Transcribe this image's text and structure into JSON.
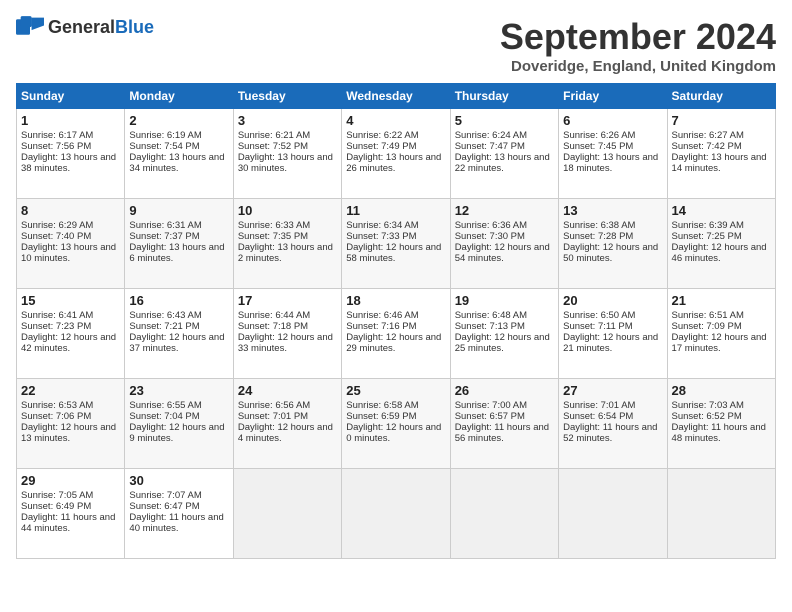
{
  "header": {
    "logo_general": "General",
    "logo_blue": "Blue",
    "month_year": "September 2024",
    "location": "Doveridge, England, United Kingdom"
  },
  "days_of_week": [
    "Sunday",
    "Monday",
    "Tuesday",
    "Wednesday",
    "Thursday",
    "Friday",
    "Saturday"
  ],
  "weeks": [
    [
      {
        "day": "1",
        "sunrise": "6:17 AM",
        "sunset": "7:56 PM",
        "daylight": "13 hours and 38 minutes."
      },
      {
        "day": "2",
        "sunrise": "6:19 AM",
        "sunset": "7:54 PM",
        "daylight": "13 hours and 34 minutes."
      },
      {
        "day": "3",
        "sunrise": "6:21 AM",
        "sunset": "7:52 PM",
        "daylight": "13 hours and 30 minutes."
      },
      {
        "day": "4",
        "sunrise": "6:22 AM",
        "sunset": "7:49 PM",
        "daylight": "13 hours and 26 minutes."
      },
      {
        "day": "5",
        "sunrise": "6:24 AM",
        "sunset": "7:47 PM",
        "daylight": "13 hours and 22 minutes."
      },
      {
        "day": "6",
        "sunrise": "6:26 AM",
        "sunset": "7:45 PM",
        "daylight": "13 hours and 18 minutes."
      },
      {
        "day": "7",
        "sunrise": "6:27 AM",
        "sunset": "7:42 PM",
        "daylight": "13 hours and 14 minutes."
      }
    ],
    [
      {
        "day": "8",
        "sunrise": "6:29 AM",
        "sunset": "7:40 PM",
        "daylight": "13 hours and 10 minutes."
      },
      {
        "day": "9",
        "sunrise": "6:31 AM",
        "sunset": "7:37 PM",
        "daylight": "13 hours and 6 minutes."
      },
      {
        "day": "10",
        "sunrise": "6:33 AM",
        "sunset": "7:35 PM",
        "daylight": "13 hours and 2 minutes."
      },
      {
        "day": "11",
        "sunrise": "6:34 AM",
        "sunset": "7:33 PM",
        "daylight": "12 hours and 58 minutes."
      },
      {
        "day": "12",
        "sunrise": "6:36 AM",
        "sunset": "7:30 PM",
        "daylight": "12 hours and 54 minutes."
      },
      {
        "day": "13",
        "sunrise": "6:38 AM",
        "sunset": "7:28 PM",
        "daylight": "12 hours and 50 minutes."
      },
      {
        "day": "14",
        "sunrise": "6:39 AM",
        "sunset": "7:25 PM",
        "daylight": "12 hours and 46 minutes."
      }
    ],
    [
      {
        "day": "15",
        "sunrise": "6:41 AM",
        "sunset": "7:23 PM",
        "daylight": "12 hours and 42 minutes."
      },
      {
        "day": "16",
        "sunrise": "6:43 AM",
        "sunset": "7:21 PM",
        "daylight": "12 hours and 37 minutes."
      },
      {
        "day": "17",
        "sunrise": "6:44 AM",
        "sunset": "7:18 PM",
        "daylight": "12 hours and 33 minutes."
      },
      {
        "day": "18",
        "sunrise": "6:46 AM",
        "sunset": "7:16 PM",
        "daylight": "12 hours and 29 minutes."
      },
      {
        "day": "19",
        "sunrise": "6:48 AM",
        "sunset": "7:13 PM",
        "daylight": "12 hours and 25 minutes."
      },
      {
        "day": "20",
        "sunrise": "6:50 AM",
        "sunset": "7:11 PM",
        "daylight": "12 hours and 21 minutes."
      },
      {
        "day": "21",
        "sunrise": "6:51 AM",
        "sunset": "7:09 PM",
        "daylight": "12 hours and 17 minutes."
      }
    ],
    [
      {
        "day": "22",
        "sunrise": "6:53 AM",
        "sunset": "7:06 PM",
        "daylight": "12 hours and 13 minutes."
      },
      {
        "day": "23",
        "sunrise": "6:55 AM",
        "sunset": "7:04 PM",
        "daylight": "12 hours and 9 minutes."
      },
      {
        "day": "24",
        "sunrise": "6:56 AM",
        "sunset": "7:01 PM",
        "daylight": "12 hours and 4 minutes."
      },
      {
        "day": "25",
        "sunrise": "6:58 AM",
        "sunset": "6:59 PM",
        "daylight": "12 hours and 0 minutes."
      },
      {
        "day": "26",
        "sunrise": "7:00 AM",
        "sunset": "6:57 PM",
        "daylight": "11 hours and 56 minutes."
      },
      {
        "day": "27",
        "sunrise": "7:01 AM",
        "sunset": "6:54 PM",
        "daylight": "11 hours and 52 minutes."
      },
      {
        "day": "28",
        "sunrise": "7:03 AM",
        "sunset": "6:52 PM",
        "daylight": "11 hours and 48 minutes."
      }
    ],
    [
      {
        "day": "29",
        "sunrise": "7:05 AM",
        "sunset": "6:49 PM",
        "daylight": "11 hours and 44 minutes."
      },
      {
        "day": "30",
        "sunrise": "7:07 AM",
        "sunset": "6:47 PM",
        "daylight": "11 hours and 40 minutes."
      },
      {
        "day": "",
        "sunrise": "",
        "sunset": "",
        "daylight": ""
      },
      {
        "day": "",
        "sunrise": "",
        "sunset": "",
        "daylight": ""
      },
      {
        "day": "",
        "sunrise": "",
        "sunset": "",
        "daylight": ""
      },
      {
        "day": "",
        "sunrise": "",
        "sunset": "",
        "daylight": ""
      },
      {
        "day": "",
        "sunrise": "",
        "sunset": "",
        "daylight": ""
      }
    ]
  ]
}
